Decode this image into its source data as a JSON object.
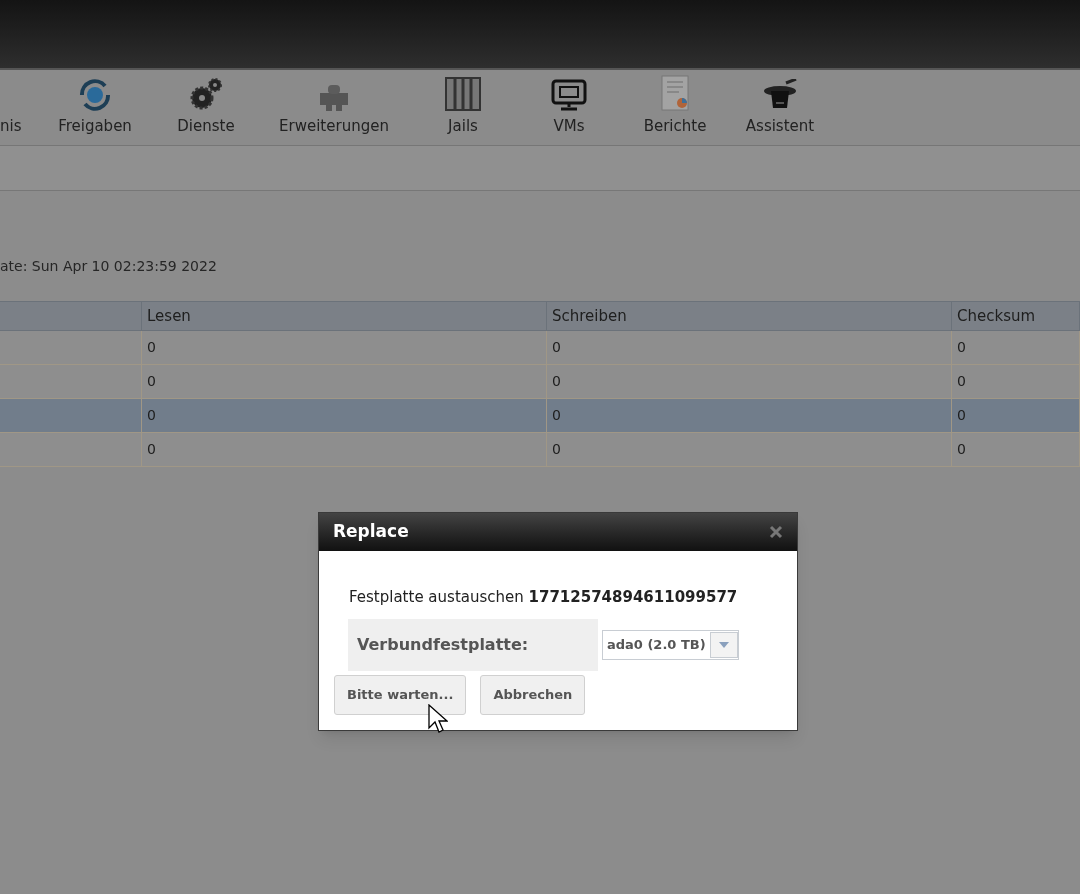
{
  "toolbar": {
    "items": [
      {
        "label": "nis",
        "kind": "none"
      },
      {
        "label": "Freigaben",
        "kind": "sharing"
      },
      {
        "label": "Dienste",
        "kind": "services"
      },
      {
        "label": "Erweiterungen",
        "kind": "plugins"
      },
      {
        "label": "Jails",
        "kind": "jails"
      },
      {
        "label": "VMs",
        "kind": "vms"
      },
      {
        "label": "Berichte",
        "kind": "reports"
      },
      {
        "label": "Assistent",
        "kind": "wizard"
      }
    ]
  },
  "status_text": "ate: Sun Apr 10 02:23:59 2022",
  "table": {
    "columns": [
      "Lesen",
      "Schreiben",
      "Checksum"
    ],
    "rows": [
      {
        "cells": [
          "0",
          "0",
          "0"
        ],
        "selected": false
      },
      {
        "cells": [
          "0",
          "0",
          "0"
        ],
        "selected": false
      },
      {
        "cells": [
          "0",
          "0",
          "0"
        ],
        "selected": true
      },
      {
        "cells": [
          "0",
          "0",
          "0"
        ],
        "selected": false
      }
    ]
  },
  "dialog": {
    "title": "Replace",
    "message": "Festplatte austauschen **17712574894611099577**",
    "field_label": "Verbundfestplatte:",
    "select_value": "ada0 (2.0 TB)",
    "buttons": [
      "Bitte warten...",
      "Abbrechen"
    ]
  }
}
